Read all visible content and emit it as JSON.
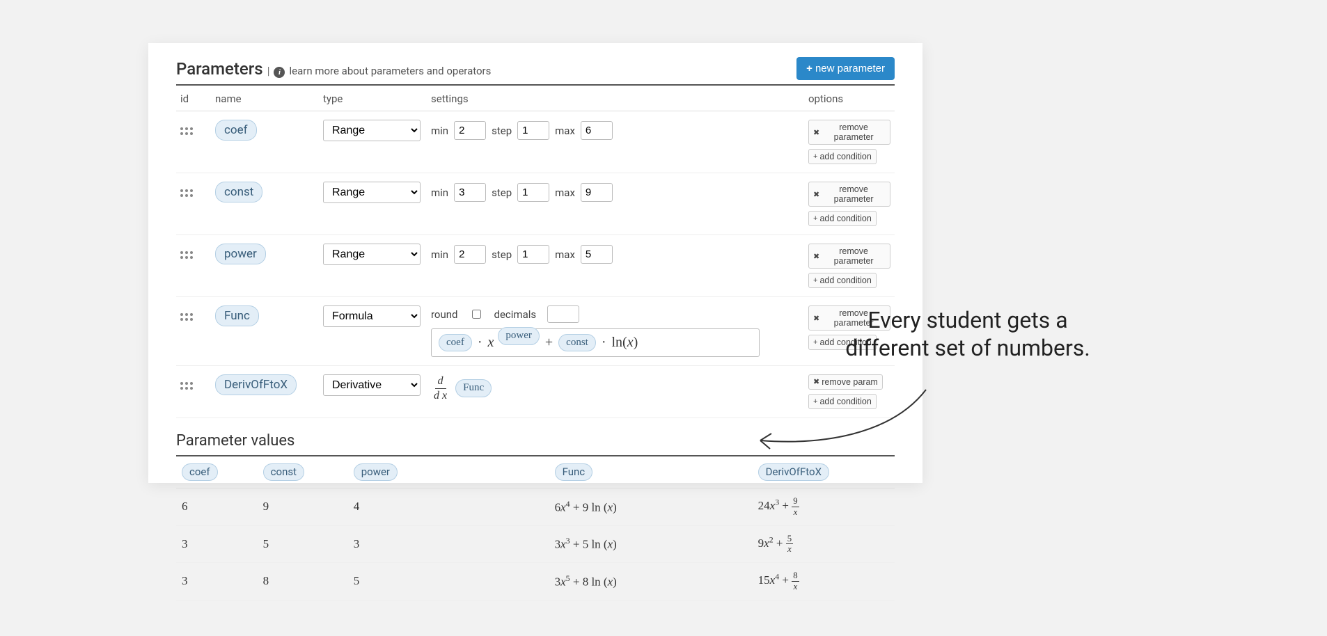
{
  "section": {
    "title": "Parameters",
    "learn_link": "learn more about parameters and operators",
    "new_button": "new parameter"
  },
  "columns": {
    "id": "id",
    "name": "name",
    "type": "type",
    "settings": "settings",
    "options": "options"
  },
  "labels": {
    "min": "min",
    "step": "step",
    "max": "max",
    "round": "round",
    "decimals": "decimals",
    "remove": "remove parameter",
    "remove_short": "remove param",
    "add_cond": "add condition"
  },
  "type_options": {
    "range": "Range",
    "formula": "Formula",
    "derivative": "Derivative"
  },
  "params": [
    {
      "name": "coef",
      "type": "Range",
      "min": "2",
      "step": "1",
      "max": "6"
    },
    {
      "name": "const",
      "type": "Range",
      "min": "3",
      "step": "1",
      "max": "9"
    },
    {
      "name": "power",
      "type": "Range",
      "min": "2",
      "step": "1",
      "max": "5"
    },
    {
      "name": "Func",
      "type": "Formula",
      "formula_parts": {
        "p1": "coef",
        "p2": "power",
        "p3": "const"
      }
    },
    {
      "name": "DerivOfFtoX",
      "type": "Derivative",
      "deriv_of": "Func"
    }
  ],
  "values_section_title": "Parameter values",
  "value_columns": [
    "coef",
    "const",
    "power",
    "Func",
    "DerivOfFtoX"
  ],
  "values": [
    {
      "coef": "6",
      "const": "9",
      "power": "4",
      "func_coef": "6",
      "func_pow": "4",
      "func_const": "9",
      "der_coef": "24",
      "der_pow": "3",
      "der_frac_num": "9"
    },
    {
      "coef": "3",
      "const": "5",
      "power": "3",
      "func_coef": "3",
      "func_pow": "3",
      "func_const": "5",
      "der_coef": "9",
      "der_pow": "2",
      "der_frac_num": "5"
    },
    {
      "coef": "3",
      "const": "8",
      "power": "5",
      "func_coef": "3",
      "func_pow": "5",
      "func_const": "8",
      "der_coef": "15",
      "der_pow": "4",
      "der_frac_num": "8"
    }
  ],
  "annotation": "Every student gets a different set of numbers."
}
